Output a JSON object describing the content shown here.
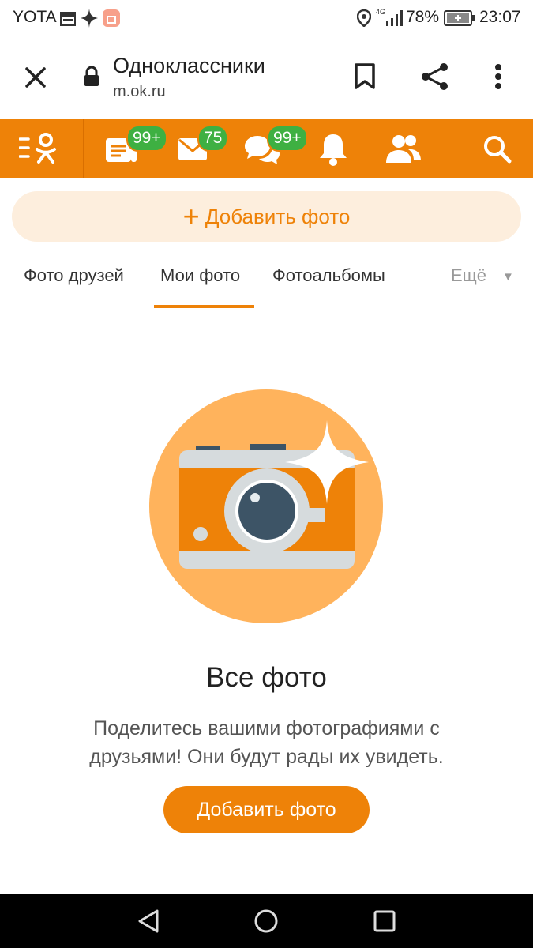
{
  "status_bar": {
    "carrier": "YOTA",
    "network": "4G",
    "battery": "78%",
    "time": "23:07"
  },
  "browser": {
    "title": "Одноклассники",
    "url": "m.ok.ru",
    "icons": [
      "close-icon",
      "lock-icon",
      "bookmark-icon",
      "share-icon",
      "more-vert-icon"
    ]
  },
  "ok_header": {
    "feed_badge": "99+",
    "messages_badge": "75",
    "discussions_badge": "99+",
    "accent_color": "#ee8208",
    "badge_color": "#3eb042"
  },
  "add_photo_top": {
    "plus": "+",
    "label": "Добавить фото"
  },
  "tabs": [
    {
      "label": "Фото друзей"
    },
    {
      "label": "Мои фото"
    },
    {
      "label": "Фотоальбомы"
    },
    {
      "label": "Ещё"
    }
  ],
  "more_arrow": "▼",
  "empty_state": {
    "title": "Все фото",
    "text": "Поделитесь вашими фотографиями с друзьями! Они будут рады их увидеть.",
    "button": "Добавить фото"
  }
}
